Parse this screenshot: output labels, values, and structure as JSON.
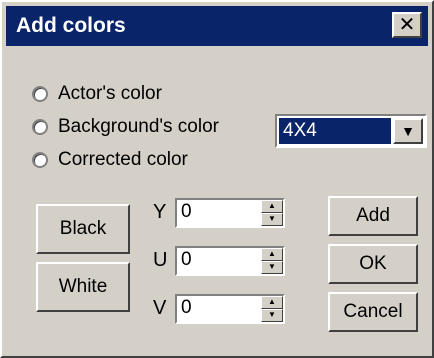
{
  "window": {
    "title": "Add colors",
    "close_glyph": "✕"
  },
  "color_options": [
    {
      "label": "Actor's color"
    },
    {
      "label": "Background's color"
    },
    {
      "label": "Corrected color"
    }
  ],
  "grid_select": {
    "value": "4X4",
    "arrow": "▼"
  },
  "preset_buttons": {
    "black": "Black",
    "white": "White"
  },
  "yuv": {
    "y": {
      "label": "Y",
      "value": "0"
    },
    "u": {
      "label": "U",
      "value": "0"
    },
    "v": {
      "label": "V",
      "value": "0"
    }
  },
  "actions": {
    "add": "Add",
    "ok": "OK",
    "cancel": "Cancel"
  },
  "icons": {
    "close": "close-icon",
    "dropdown": "chevron-down-icon",
    "spin_up": "spin-up-icon",
    "spin_down": "spin-down-icon"
  },
  "colors": {
    "titlebar": "#0a246a",
    "dialog_face": "#d4d0c8",
    "selection": "#0a246a"
  }
}
